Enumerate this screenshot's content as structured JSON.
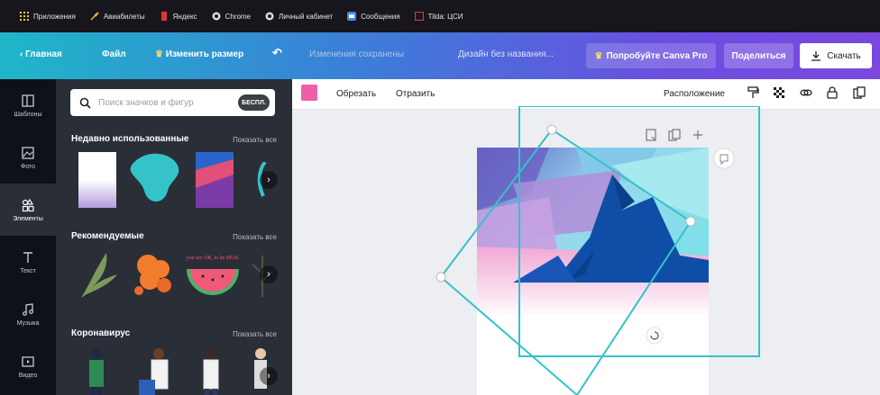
{
  "bookmarks": [
    {
      "label": "Приложения",
      "icon": "apps-grid-icon"
    },
    {
      "label": "Авиабилеты",
      "icon": "plane-icon"
    },
    {
      "label": "Яндекс",
      "icon": "yandex-icon"
    },
    {
      "label": "Chrome",
      "icon": "chrome-icon"
    },
    {
      "label": "Личный кабинет",
      "icon": "chrome-icon"
    },
    {
      "label": "Сообщения",
      "icon": "messages-icon"
    },
    {
      "label": "Tilda: ЦСИ",
      "icon": "tilda-icon"
    }
  ],
  "topbar": {
    "home": "Главная",
    "file": "Файл",
    "resize": "Изменить размер",
    "saved_status": "Изменения сохранены",
    "design_title": "Дизайн без названия...",
    "try_pro": "Попробуйте Canva Pro",
    "share": "Поделиться",
    "download": "Скачать"
  },
  "rail": [
    {
      "label": "Шаблоны",
      "icon": "templates-icon"
    },
    {
      "label": "Фото",
      "icon": "photo-icon"
    },
    {
      "label": "Элементы",
      "icon": "elements-icon",
      "active": true
    },
    {
      "label": "Текст",
      "icon": "text-icon"
    },
    {
      "label": "Музыка",
      "icon": "music-icon"
    },
    {
      "label": "Видео",
      "icon": "video-icon"
    }
  ],
  "panel": {
    "search_placeholder": "Поиск значков и фигур",
    "free_badge": "БЕСПЛ.",
    "sections": [
      {
        "title": "Недавно использованные",
        "show_all": "Показать все"
      },
      {
        "title": "Рекомендуемые",
        "show_all": "Показать все"
      },
      {
        "title": "Коронавирус",
        "show_all": "Показать все"
      }
    ],
    "sticker_text": "you are OK, to be REAL"
  },
  "editor_toolbar": {
    "crop": "Обрезать",
    "flip": "Отразить",
    "position": "Расположение",
    "fill_color": "#ee5fa7"
  },
  "colors": {
    "bookmarks_bg": "#17161c",
    "rail_bg": "#0e1117",
    "panel_bg": "#2a2e37",
    "selection": "#35c2c9",
    "editor_bg": "#eceef1"
  }
}
